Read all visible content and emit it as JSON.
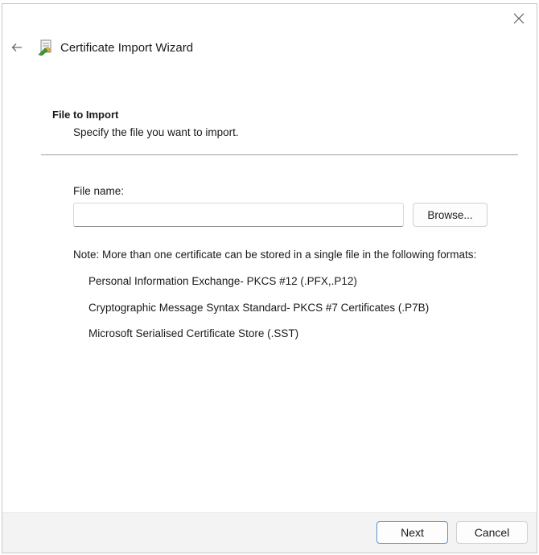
{
  "dialog": {
    "title": "Certificate Import Wizard",
    "icons": {
      "close": "close-icon",
      "back": "back-arrow-icon",
      "app": "certificate-icon"
    }
  },
  "section": {
    "heading": "File to Import",
    "subheading": "Specify the file you want to import."
  },
  "file": {
    "label": "File name:",
    "value": "",
    "browse_label": "Browse..."
  },
  "note": {
    "text": "Note:  More than one certificate can be stored in a single file in the following formats:",
    "formats": [
      "Personal Information Exchange- PKCS #12 (.PFX,.P12)",
      "Cryptographic Message Syntax Standard- PKCS #7 Certificates (.P7B)",
      "Microsoft Serialised Certificate Store (.SST)"
    ]
  },
  "footer": {
    "next_label": "Next",
    "cancel_label": "Cancel"
  },
  "colors": {
    "primary_border": "#5a8fd0",
    "footer_bg": "#f3f3f3"
  }
}
